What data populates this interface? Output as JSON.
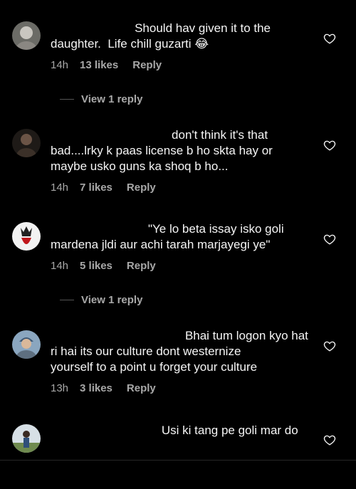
{
  "comments": [
    {
      "text": "                         Should hav given it to the\ndaughter.  Life chill guzarti 😂",
      "time": "14h",
      "likes": "13 likes",
      "reply": "Reply",
      "view_reply": "View 1 reply"
    },
    {
      "text": "                                    don't think it's that\nbad....lrky k paas license b ho skta hay or\nmaybe usko guns ka shoq b ho...",
      "time": "14h",
      "likes": "7 likes",
      "reply": "Reply"
    },
    {
      "text": "                             \"Ye lo beta issay isko goli\nmardena jldi aur achi tarah marjayegi ye\"",
      "time": "14h",
      "likes": "5 likes",
      "reply": "Reply",
      "view_reply": "View 1 reply"
    },
    {
      "text": "                                        Bhai tum logon kyo hat\nri hai its our culture dont westernize\nyourself to a point u forget your culture",
      "time": "13h",
      "likes": "3 likes",
      "reply": "Reply"
    },
    {
      "text": "                                 Usi ki tang pe goli mar do"
    }
  ],
  "icons": {
    "like": "heart-outline-icon",
    "avatar": "user-avatar"
  },
  "colors": {
    "background": "#000000",
    "text": "#f5f5f5",
    "muted": "#a8a8a8"
  }
}
